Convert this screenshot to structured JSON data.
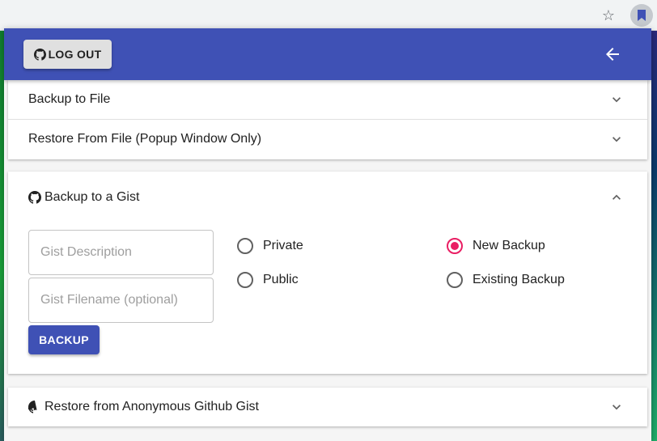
{
  "browser": {
    "star_icon": "star-outline-icon",
    "extension_icon": "bookmark-icon"
  },
  "header": {
    "logout_label": "LOG OUT",
    "logout_icon": "github-icon",
    "back_icon": "arrow-back-icon",
    "color": "#3f51b5"
  },
  "panels": {
    "backup_file": {
      "title": "Backup to File",
      "expanded": false
    },
    "restore_file": {
      "title": "Restore From File (Popup Window Only)",
      "expanded": false
    },
    "backup_gist": {
      "title": "Backup to a Gist",
      "expanded": true,
      "description_placeholder": "Gist Description",
      "filename_placeholder": "Gist Filename (optional)",
      "backup_label": "BACKUP",
      "visibility_options": [
        {
          "label": "Private",
          "checked": false
        },
        {
          "label": "Public",
          "checked": false
        }
      ],
      "mode_options": [
        {
          "label": "New Backup",
          "checked": true
        },
        {
          "label": "Existing Backup",
          "checked": false
        }
      ]
    },
    "restore_gist": {
      "title": "Restore from Anonymous Github Gist",
      "expanded": false
    }
  },
  "colors": {
    "primary": "#3f51b5",
    "accent": "#e91e63"
  }
}
